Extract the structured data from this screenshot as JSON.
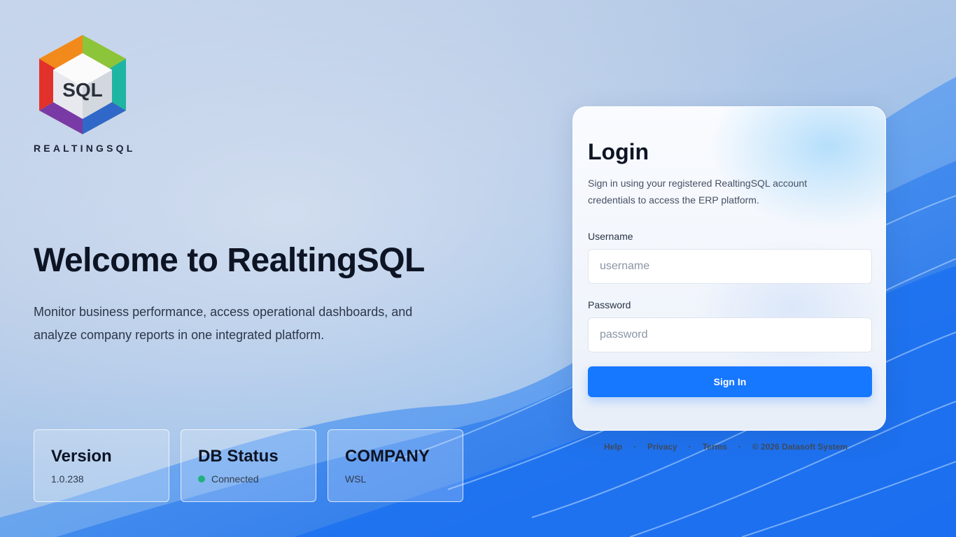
{
  "brand": {
    "name": "REALTINGSQL",
    "logo_text": "SQL",
    "logo_icon": "hexagon-cube-logo-icon"
  },
  "hero": {
    "title": "Welcome to RealtingSQL",
    "subtitle": "Monitor business performance, access operational dashboards, and analyze company reports in one integrated platform."
  },
  "info_cards": [
    {
      "title": "Version",
      "value": "1.0.238"
    },
    {
      "title": "DB Status",
      "value": "Connected",
      "status_color": "#22b07d"
    },
    {
      "title": "COMPANY",
      "value": "WSL"
    }
  ],
  "login": {
    "title": "Login",
    "description": "Sign in using your registered RealtingSQL account credentials to access the ERP platform.",
    "username_label": "Username",
    "username_placeholder": "username",
    "username_value": "",
    "password_label": "Password",
    "password_placeholder": "password",
    "password_value": "",
    "submit_label": "Sign In"
  },
  "footer": {
    "links": [
      "Help",
      "Privacy",
      "Terms"
    ],
    "separator": "·",
    "copyright": "© 2026 Datasoft System"
  },
  "colors": {
    "accent": "#1677ff",
    "status_ok": "#22b07d",
    "text_dark": "#0d1424"
  }
}
